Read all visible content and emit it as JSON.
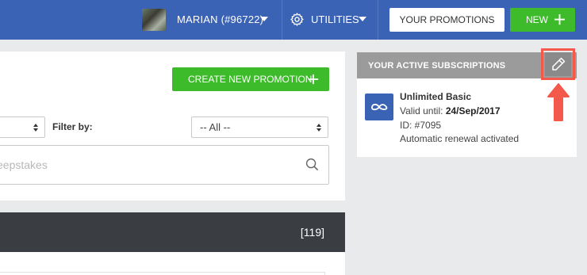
{
  "header": {
    "user_label": "MARIAN (#96722)",
    "utilities_label": "UTILITIES",
    "promotions_label": "YOUR PROMOTIONS",
    "new_label": "NEW"
  },
  "main": {
    "create_label": "CREATE NEW PROMOTION",
    "filter_label": "Filter by:",
    "filter_value": "-- All --",
    "search_placeholder": "eepstakes",
    "list_count": "[119]"
  },
  "subscriptions": {
    "title": "YOUR ACTIVE SUBSCRIPTIONS",
    "plan_name": "Unlimited Basic",
    "valid_prefix": "Valid until: ",
    "valid_date": "24/Sep/2017",
    "id_text": "ID: #7095",
    "renewal_text": "Automatic renewal activated"
  },
  "colors": {
    "brand_blue": "#3a62b5",
    "green": "#3dbb2a",
    "highlight_red": "#f35a4b",
    "dark_bar": "#3a3d42"
  },
  "icons": [
    "gear-icon",
    "plus-icon",
    "search-icon",
    "pencil-icon",
    "infinity-icon",
    "arrow-up-icon"
  ]
}
